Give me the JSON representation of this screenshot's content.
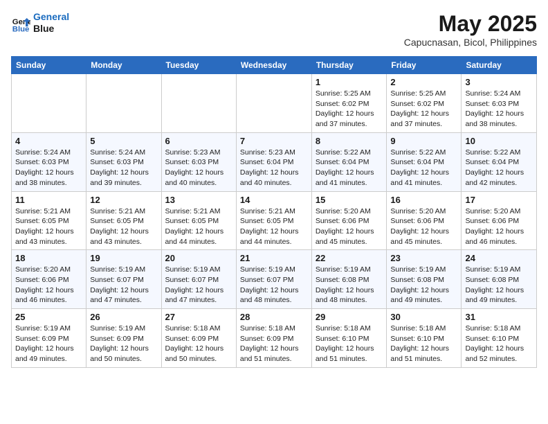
{
  "header": {
    "logo_line1": "General",
    "logo_line2": "Blue",
    "main_title": "May 2025",
    "subtitle": "Capucnasan, Bicol, Philippines"
  },
  "weekdays": [
    "Sunday",
    "Monday",
    "Tuesday",
    "Wednesday",
    "Thursday",
    "Friday",
    "Saturday"
  ],
  "weeks": [
    [
      {
        "day": "",
        "info": ""
      },
      {
        "day": "",
        "info": ""
      },
      {
        "day": "",
        "info": ""
      },
      {
        "day": "",
        "info": ""
      },
      {
        "day": "1",
        "info": "Sunrise: 5:25 AM\nSunset: 6:02 PM\nDaylight: 12 hours\nand 37 minutes."
      },
      {
        "day": "2",
        "info": "Sunrise: 5:25 AM\nSunset: 6:02 PM\nDaylight: 12 hours\nand 37 minutes."
      },
      {
        "day": "3",
        "info": "Sunrise: 5:24 AM\nSunset: 6:03 PM\nDaylight: 12 hours\nand 38 minutes."
      }
    ],
    [
      {
        "day": "4",
        "info": "Sunrise: 5:24 AM\nSunset: 6:03 PM\nDaylight: 12 hours\nand 38 minutes."
      },
      {
        "day": "5",
        "info": "Sunrise: 5:24 AM\nSunset: 6:03 PM\nDaylight: 12 hours\nand 39 minutes."
      },
      {
        "day": "6",
        "info": "Sunrise: 5:23 AM\nSunset: 6:03 PM\nDaylight: 12 hours\nand 40 minutes."
      },
      {
        "day": "7",
        "info": "Sunrise: 5:23 AM\nSunset: 6:04 PM\nDaylight: 12 hours\nand 40 minutes."
      },
      {
        "day": "8",
        "info": "Sunrise: 5:22 AM\nSunset: 6:04 PM\nDaylight: 12 hours\nand 41 minutes."
      },
      {
        "day": "9",
        "info": "Sunrise: 5:22 AM\nSunset: 6:04 PM\nDaylight: 12 hours\nand 41 minutes."
      },
      {
        "day": "10",
        "info": "Sunrise: 5:22 AM\nSunset: 6:04 PM\nDaylight: 12 hours\nand 42 minutes."
      }
    ],
    [
      {
        "day": "11",
        "info": "Sunrise: 5:21 AM\nSunset: 6:05 PM\nDaylight: 12 hours\nand 43 minutes."
      },
      {
        "day": "12",
        "info": "Sunrise: 5:21 AM\nSunset: 6:05 PM\nDaylight: 12 hours\nand 43 minutes."
      },
      {
        "day": "13",
        "info": "Sunrise: 5:21 AM\nSunset: 6:05 PM\nDaylight: 12 hours\nand 44 minutes."
      },
      {
        "day": "14",
        "info": "Sunrise: 5:21 AM\nSunset: 6:05 PM\nDaylight: 12 hours\nand 44 minutes."
      },
      {
        "day": "15",
        "info": "Sunrise: 5:20 AM\nSunset: 6:06 PM\nDaylight: 12 hours\nand 45 minutes."
      },
      {
        "day": "16",
        "info": "Sunrise: 5:20 AM\nSunset: 6:06 PM\nDaylight: 12 hours\nand 45 minutes."
      },
      {
        "day": "17",
        "info": "Sunrise: 5:20 AM\nSunset: 6:06 PM\nDaylight: 12 hours\nand 46 minutes."
      }
    ],
    [
      {
        "day": "18",
        "info": "Sunrise: 5:20 AM\nSunset: 6:06 PM\nDaylight: 12 hours\nand 46 minutes."
      },
      {
        "day": "19",
        "info": "Sunrise: 5:19 AM\nSunset: 6:07 PM\nDaylight: 12 hours\nand 47 minutes."
      },
      {
        "day": "20",
        "info": "Sunrise: 5:19 AM\nSunset: 6:07 PM\nDaylight: 12 hours\nand 47 minutes."
      },
      {
        "day": "21",
        "info": "Sunrise: 5:19 AM\nSunset: 6:07 PM\nDaylight: 12 hours\nand 48 minutes."
      },
      {
        "day": "22",
        "info": "Sunrise: 5:19 AM\nSunset: 6:08 PM\nDaylight: 12 hours\nand 48 minutes."
      },
      {
        "day": "23",
        "info": "Sunrise: 5:19 AM\nSunset: 6:08 PM\nDaylight: 12 hours\nand 49 minutes."
      },
      {
        "day": "24",
        "info": "Sunrise: 5:19 AM\nSunset: 6:08 PM\nDaylight: 12 hours\nand 49 minutes."
      }
    ],
    [
      {
        "day": "25",
        "info": "Sunrise: 5:19 AM\nSunset: 6:09 PM\nDaylight: 12 hours\nand 49 minutes."
      },
      {
        "day": "26",
        "info": "Sunrise: 5:19 AM\nSunset: 6:09 PM\nDaylight: 12 hours\nand 50 minutes."
      },
      {
        "day": "27",
        "info": "Sunrise: 5:18 AM\nSunset: 6:09 PM\nDaylight: 12 hours\nand 50 minutes."
      },
      {
        "day": "28",
        "info": "Sunrise: 5:18 AM\nSunset: 6:09 PM\nDaylight: 12 hours\nand 51 minutes."
      },
      {
        "day": "29",
        "info": "Sunrise: 5:18 AM\nSunset: 6:10 PM\nDaylight: 12 hours\nand 51 minutes."
      },
      {
        "day": "30",
        "info": "Sunrise: 5:18 AM\nSunset: 6:10 PM\nDaylight: 12 hours\nand 51 minutes."
      },
      {
        "day": "31",
        "info": "Sunrise: 5:18 AM\nSunset: 6:10 PM\nDaylight: 12 hours\nand 52 minutes."
      }
    ]
  ]
}
